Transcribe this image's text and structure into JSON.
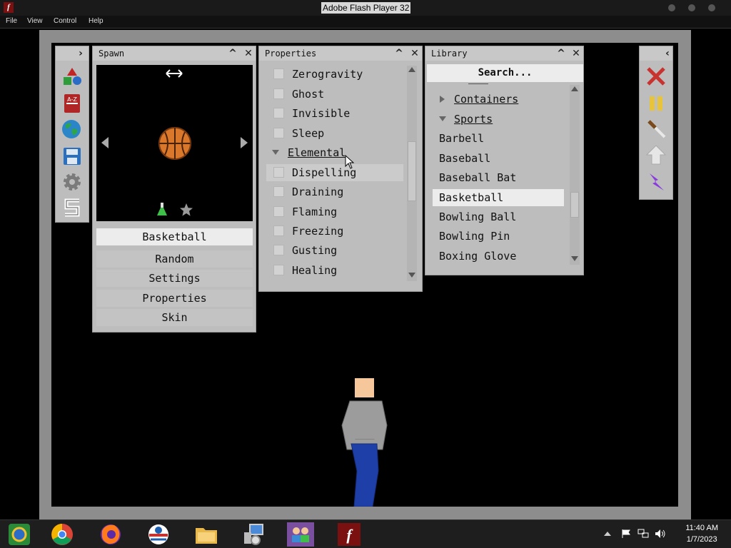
{
  "window": {
    "title": "Adobe Flash Player 32",
    "menu": [
      "File",
      "View",
      "Control",
      "Help"
    ]
  },
  "spawn": {
    "title": "Spawn",
    "selected_item": "Basketball",
    "buttons": [
      "Random",
      "Settings",
      "Properties",
      "Skin"
    ]
  },
  "properties": {
    "title": "Properties",
    "items": [
      {
        "label": "Zerogravity",
        "type": "checkbox"
      },
      {
        "label": "Ghost",
        "type": "checkbox"
      },
      {
        "label": "Invisible",
        "type": "checkbox"
      },
      {
        "label": "Sleep",
        "type": "checkbox"
      },
      {
        "label": "Elemental",
        "type": "group"
      },
      {
        "label": "Dispelling",
        "type": "checkbox"
      },
      {
        "label": "Draining",
        "type": "checkbox"
      },
      {
        "label": "Flaming",
        "type": "checkbox"
      },
      {
        "label": "Freezing",
        "type": "checkbox"
      },
      {
        "label": "Gusting",
        "type": "checkbox"
      },
      {
        "label": "Healing",
        "type": "checkbox"
      }
    ]
  },
  "library": {
    "title": "Library",
    "search_placeholder": "Search...",
    "groups": [
      "Containers",
      "Sports"
    ],
    "items": [
      "Barbell",
      "Baseball",
      "Baseball Bat",
      "Basketball",
      "Bowling Ball",
      "Bowling Pin",
      "Boxing Glove"
    ],
    "selected": "Basketball"
  },
  "colors": {
    "panel_bg": "#bdbdbd",
    "ball": "#d9782a",
    "delete_tool": "#c8322f",
    "pause_tool": "#e8c43a",
    "lightning_tool": "#8a3be0",
    "figure_shirt": "#9c9c9c",
    "figure_pants": "#1f3fa8",
    "figure_skin": "#f6c79a"
  },
  "tools_left": [
    "shapes-icon",
    "dictionary-icon",
    "globe-icon",
    "save-icon",
    "gear-icon",
    "s-logo-icon"
  ],
  "tools_right": [
    "delete-icon",
    "pause-icon",
    "knife-icon",
    "arrow-up-icon",
    "lightning-icon"
  ],
  "taskbar": {
    "time": "11:40 AM",
    "date": "1/7/2023"
  }
}
